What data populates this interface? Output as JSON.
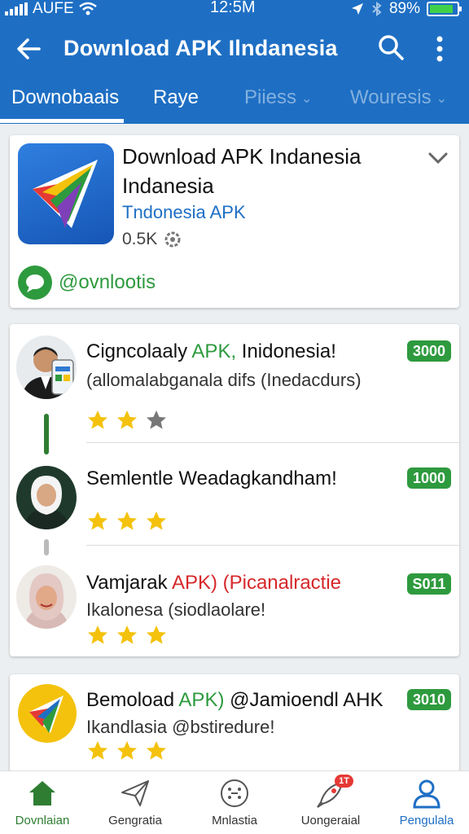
{
  "status_bar": {
    "carrier": "AUFE",
    "time": "12:5M",
    "battery": "89%",
    "battery_level": 0.89
  },
  "toolbar": {
    "title": "Download APK Ilndanesia",
    "back_icon": "arrow-left-icon",
    "search_icon": "search-icon",
    "more_icon": "more-vert-icon"
  },
  "tabs": [
    {
      "label": "Downobaais",
      "active": true
    },
    {
      "label": "Raye",
      "active": false
    },
    {
      "label": "Piiess",
      "active": false
    },
    {
      "label": "Wouresis",
      "active": false
    }
  ],
  "featured": {
    "title": "Download APK Indanesia Indanesia",
    "subtitle": "Tndonesia APK",
    "size": "0.5K",
    "handle": "@ovnlootis"
  },
  "list": [
    {
      "title_plain": "Cigncolaaly ",
      "title_green": "APK,",
      "title_tail": " Inidonesia!",
      "subtitle": "(allomalabganala difs (Inedacdurs)",
      "badge": "3000",
      "rating": 2,
      "max_rating": 3
    },
    {
      "title_plain": "Semlentle Weadagkandham!",
      "badge": "1000",
      "rating": 3,
      "max_rating": 3
    },
    {
      "title_plain": "Vamjarak ",
      "title_red": "APK) (Picanalractie",
      "subtitle": "Ikalonesa (siodlaolare!",
      "badge": "S011",
      "rating": 3,
      "max_rating": 3
    }
  ],
  "card3": {
    "title_plain": "Bemoload ",
    "title_green": "APK)",
    "title_tail": " @Jamioendl AHK",
    "subtitle": "Ikandlasia @bstiredure!",
    "badge": "3010",
    "rating": 3
  },
  "bottom_nav": [
    {
      "label": "Dovnlaian",
      "icon": "home-icon"
    },
    {
      "label": "Gengratia",
      "icon": "paper-plane-icon"
    },
    {
      "label": "Mnlastia",
      "icon": "dial-icon"
    },
    {
      "label": "Uongeraial",
      "icon": "rocket-icon",
      "badge": "1T"
    },
    {
      "label": "Pengulala",
      "icon": "profile-icon"
    }
  ],
  "colors": {
    "primary": "#1e6fc4",
    "green": "#2e9a3e",
    "red": "#d6282a",
    "star": "#f4c20d"
  }
}
